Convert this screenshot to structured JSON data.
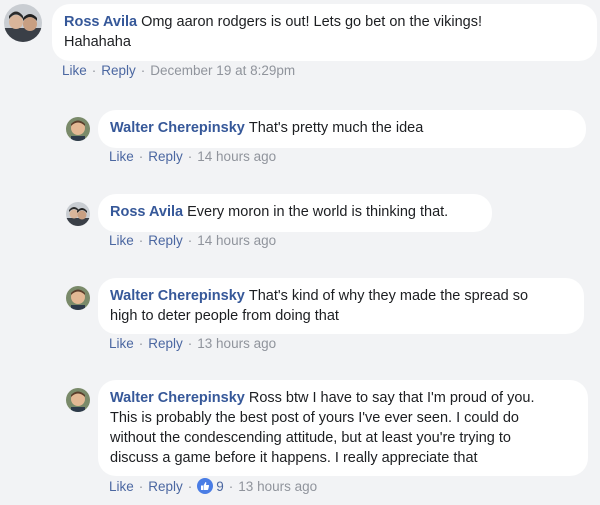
{
  "comments": [
    {
      "author": "Ross Avila",
      "text_lines": [
        "Omg aaron rodgers is out! Lets go bet on the vikings!",
        "Hahahaha"
      ],
      "like_label": "Like",
      "reply_label": "Reply",
      "time": "December 19 at 8:29pm"
    },
    {
      "author": "Walter Cherepinsky",
      "text_lines": [
        "That's pretty much the idea"
      ],
      "like_label": "Like",
      "reply_label": "Reply",
      "time": "14 hours ago"
    },
    {
      "author": "Ross Avila",
      "text_lines": [
        "Every moron in the world is thinking that."
      ],
      "like_label": "Like",
      "reply_label": "Reply",
      "time": "14 hours ago"
    },
    {
      "author": "Walter Cherepinsky",
      "text_lines": [
        "That's kind of why they made the spread so",
        "high to deter people from doing that"
      ],
      "like_label": "Like",
      "reply_label": "Reply",
      "time": "13 hours ago"
    },
    {
      "author": "Walter Cherepinsky",
      "text_lines": [
        "Ross btw I have to say that I'm proud of you.",
        "This is probably the best post of yours I've ever seen. I could do",
        "without the condescending attitude, but at least you're trying to",
        "discuss a game before it happens. I really appreciate that"
      ],
      "like_label": "Like",
      "reply_label": "Reply",
      "reaction_count": "9",
      "reaction_icon": "thumbs-up-icon",
      "time": "13 hours ago"
    }
  ],
  "separator": "·",
  "colors": {
    "name": "#365899",
    "link": "#4b67a1",
    "meta": "#90949c",
    "reaction": "#4a7de5",
    "background": "#f2f3f5",
    "bubble": "#ffffff"
  }
}
